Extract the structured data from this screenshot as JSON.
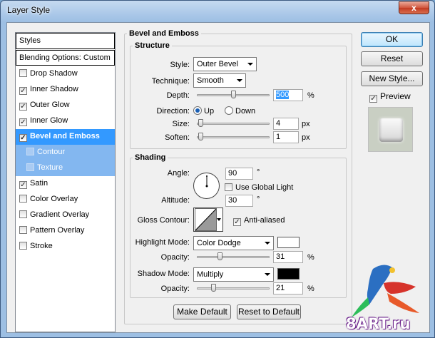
{
  "window": {
    "title": "Layer Style",
    "close_glyph": "x"
  },
  "styles_panel": {
    "header": "Styles",
    "blending": "Blending Options: Custom",
    "items": [
      {
        "label": "Drop Shadow",
        "checked": false
      },
      {
        "label": "Inner Shadow",
        "checked": true
      },
      {
        "label": "Outer Glow",
        "checked": true
      },
      {
        "label": "Inner Glow",
        "checked": true
      },
      {
        "label": "Bevel and Emboss",
        "checked": true,
        "selected": true
      },
      {
        "label": "Contour",
        "checked": false,
        "sub": true
      },
      {
        "label": "Texture",
        "checked": false,
        "sub": true
      },
      {
        "label": "Satin",
        "checked": true
      },
      {
        "label": "Color Overlay",
        "checked": false
      },
      {
        "label": "Gradient Overlay",
        "checked": false
      },
      {
        "label": "Pattern Overlay",
        "checked": false
      },
      {
        "label": "Stroke",
        "checked": false
      }
    ]
  },
  "bevel": {
    "title": "Bevel and Emboss",
    "structure": {
      "title": "Structure",
      "style_label": "Style:",
      "style_value": "Outer Bevel",
      "technique_label": "Technique:",
      "technique_value": "Smooth",
      "depth_label": "Depth:",
      "depth_value": "500",
      "depth_unit": "%",
      "direction_label": "Direction:",
      "direction_up": "Up",
      "direction_down": "Down",
      "size_label": "Size:",
      "size_value": "4",
      "size_unit": "px",
      "soften_label": "Soften:",
      "soften_value": "1",
      "soften_unit": "px"
    },
    "shading": {
      "title": "Shading",
      "angle_label": "Angle:",
      "angle_value": "90",
      "angle_unit": "°",
      "global_light_label": "Use Global Light",
      "altitude_label": "Altitude:",
      "altitude_value": "30",
      "altitude_unit": "°",
      "gloss_label": "Gloss Contour:",
      "anti_aliased_label": "Anti-aliased",
      "highlight_mode_label": "Highlight Mode:",
      "highlight_mode_value": "Color Dodge",
      "highlight_color": "#ffffff",
      "highlight_opacity_label": "Opacity:",
      "highlight_opacity_value": "31",
      "highlight_opacity_unit": "%",
      "shadow_mode_label": "Shadow Mode:",
      "shadow_mode_value": "Multiply",
      "shadow_color": "#000000",
      "shadow_opacity_label": "Opacity:",
      "shadow_opacity_value": "21",
      "shadow_opacity_unit": "%"
    },
    "make_default": "Make Default",
    "reset_default": "Reset to Default"
  },
  "sliders": {
    "depth": 0.5,
    "size": 0.02,
    "soften": 0.02,
    "highlight_opacity": 0.31,
    "shadow_opacity": 0.21
  },
  "side_buttons": {
    "ok": "OK",
    "reset": "Reset",
    "new_style": "New Style...",
    "preview_label": "Preview"
  },
  "watermark": "8ART.ru"
}
